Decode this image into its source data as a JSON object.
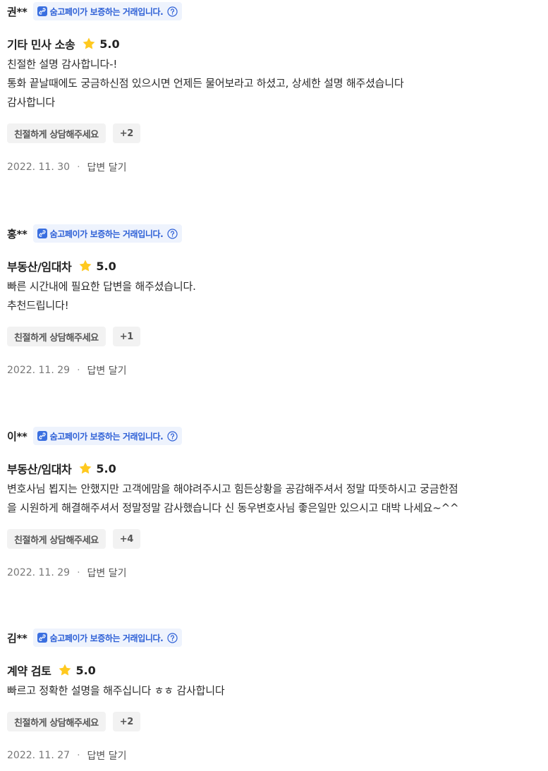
{
  "badge_text": "숨고페이가 보증하는 거래입니다.",
  "reply_label": "답변 달기",
  "dot": "·",
  "colors": {
    "badge_bg": "#eef3fd",
    "badge_text": "#2c5fd6",
    "star": "#ffc91f",
    "tag_bg": "#f2f2f2"
  },
  "icons": {
    "badge": "link-icon",
    "help": "question-circle-icon",
    "star": "star-icon"
  },
  "reviews": [
    {
      "name": "권**",
      "service": "기타 민사 소송",
      "rating": "5.0",
      "text": "친절한 설명 감사합니다-!\n통화 끝날때에도 궁금하신점 있으시면 언제든 물어보라고 하셨고, 상세한 설명 해주셨습니다\n감사합니다",
      "tag": "친절하게 상담해주세요",
      "more": "+2",
      "date": "2022. 11. 30"
    },
    {
      "name": "홍**",
      "service": "부동산/임대차",
      "rating": "5.0",
      "text": "빠른 시간내에 필요한 답변을 해주셨습니다.\n추천드립니다!",
      "tag": "친절하게 상담해주세요",
      "more": "+1",
      "date": "2022. 11. 29"
    },
    {
      "name": "이**",
      "service": "부동산/임대차",
      "rating": "5.0",
      "text": "변호사님 뵙지는 안했지만 고객에맘을 해야려주시고 힘든상황을 공감해주셔서 정말 따뜻하시고  궁금한점\n을 시원하게 해결해주셔서 정말정말 감사했습니다 신 동우변호사님 좋은일만 있으시고 대박 나세요~^^",
      "tag": "친절하게 상담해주세요",
      "more": "+4",
      "date": "2022. 11. 29"
    },
    {
      "name": "김**",
      "service": "계약 검토",
      "rating": "5.0",
      "text": "빠르고 정확한 설명을 해주십니다 ㅎㅎ 감사합니다",
      "tag": "친절하게 상담해주세요",
      "more": "+2",
      "date": "2022. 11. 27"
    }
  ]
}
